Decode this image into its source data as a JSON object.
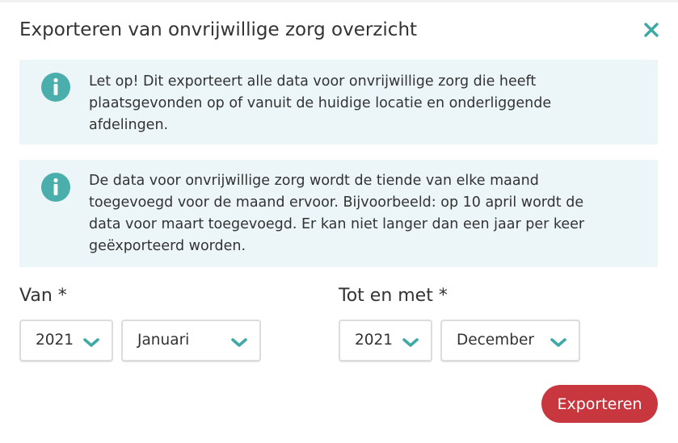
{
  "dialog": {
    "title": "Exporteren van onvrijwillige zorg overzicht",
    "close_icon": "close-icon",
    "accent_color": "#3fa9a6"
  },
  "notices": [
    {
      "icon": "info-icon",
      "text": "Let op! Dit exporteert alle data voor onvrijwillige zorg die heeft plaatsgevonden op of vanuit de huidige locatie en onderliggende afdelingen."
    },
    {
      "icon": "info-icon",
      "text": "De data voor onvrijwillige zorg wordt de tiende van elke maand toegevoegd voor de maand ervoor. Bijvoorbeeld: op 10 april wordt de data voor maart toegevoegd. Er kan niet langer dan een jaar per keer geëxporteerd worden."
    }
  ],
  "from": {
    "label": "Van *",
    "year": "2021",
    "month": "Januari"
  },
  "to": {
    "label": "Tot en met *",
    "year": "2021",
    "month": "December"
  },
  "actions": {
    "export_label": "Exporteren",
    "export_color": "#c8363e"
  }
}
